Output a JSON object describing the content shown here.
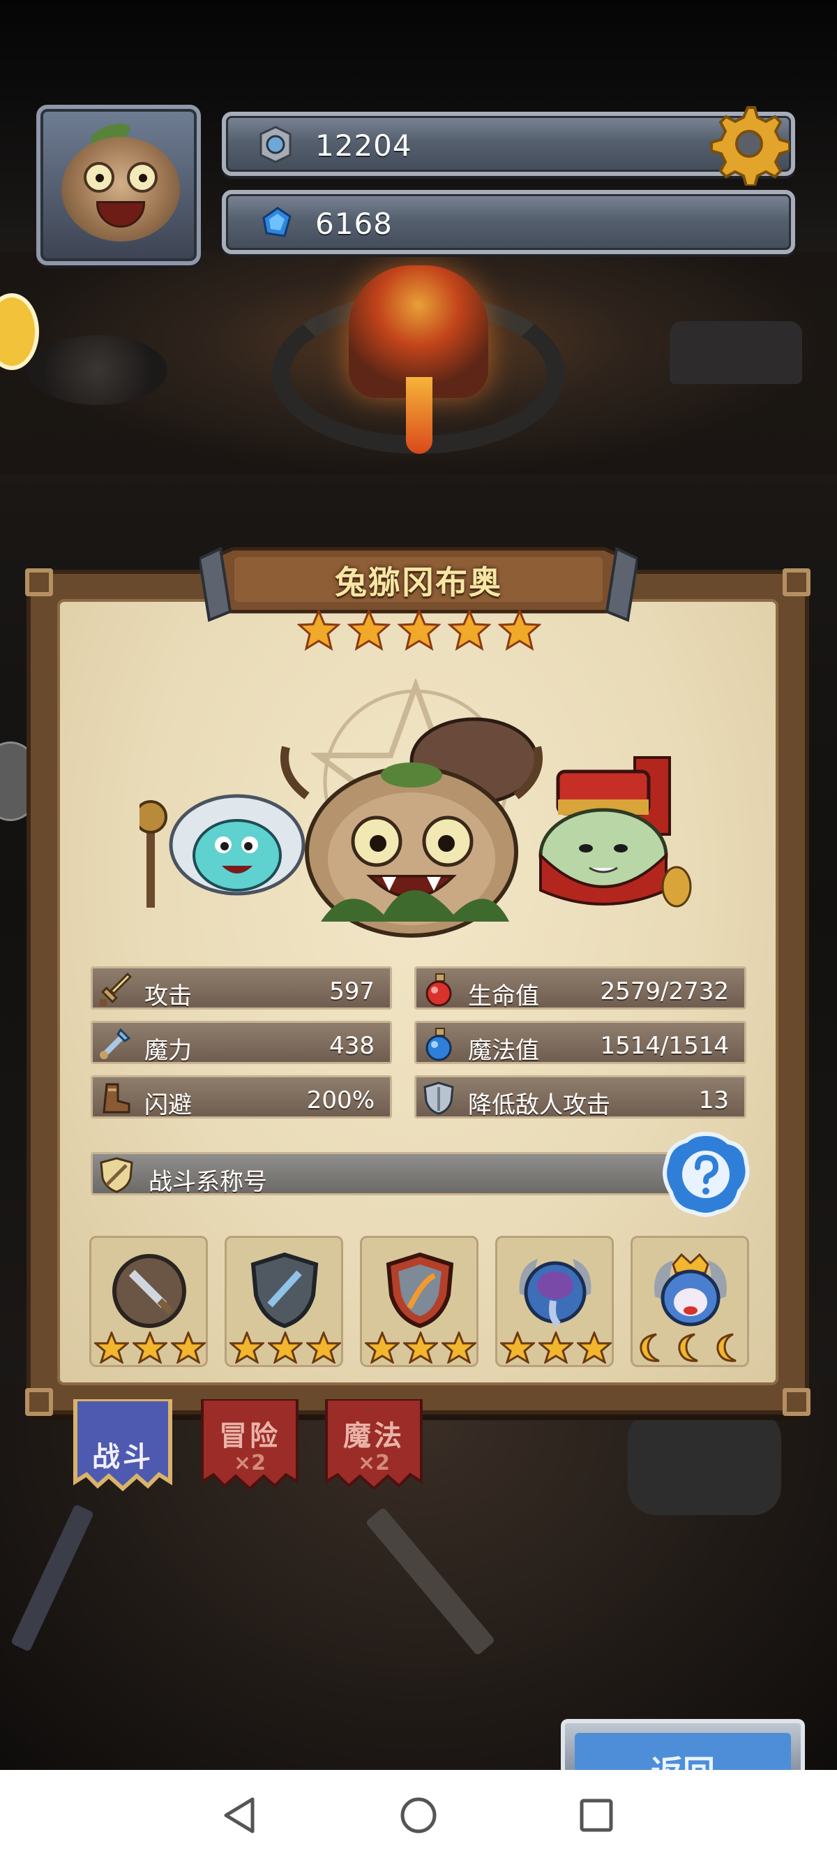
{
  "resources": {
    "gems": "12204",
    "crystals": "6168"
  },
  "character": {
    "name": "兔猕冈布奥",
    "star_count": 5
  },
  "stats": {
    "attack": {
      "label": "攻击",
      "value": "597"
    },
    "hp": {
      "label": "生命值",
      "value": "2579/2732"
    },
    "magic_power": {
      "label": "魔力",
      "value": "438"
    },
    "mp": {
      "label": "魔法值",
      "value": "1514/1514"
    },
    "dodge": {
      "label": "闪避",
      "value": "200%"
    },
    "reduce_attack": {
      "label": "降低敌人攻击",
      "value": "13"
    }
  },
  "combat_title": {
    "label": "战斗系称号"
  },
  "badges": [
    {
      "name": "sword-badge",
      "stars": 3,
      "type": "star"
    },
    {
      "name": "shield-badge",
      "stars": 3,
      "type": "star"
    },
    {
      "name": "fire-shield-badge",
      "stars": 3,
      "type": "star"
    },
    {
      "name": "elephant-badge",
      "stars": 3,
      "type": "star"
    },
    {
      "name": "ox-king-badge",
      "stars": 3,
      "type": "moon"
    }
  ],
  "tabs": [
    {
      "label": "战斗",
      "mult": "",
      "active": true
    },
    {
      "label": "冒险",
      "mult": "×2",
      "active": false
    },
    {
      "label": "魔法",
      "mult": "×2",
      "active": false
    }
  ],
  "return_button": {
    "label": "返回"
  },
  "colors": {
    "star": "#f0a928",
    "panel": "#e9dbb7",
    "tab_active": "#4e5ab0",
    "tab_inactive": "#a3302a",
    "help": "#2f7fd8"
  }
}
